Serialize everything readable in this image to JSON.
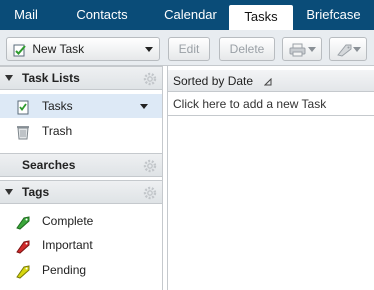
{
  "top_tabs": [
    "Mail",
    "Contacts",
    "Calendar",
    "Tasks",
    "Briefcase"
  ],
  "active_tab": "Tasks",
  "toolbar": {
    "new_task_label": "New Task",
    "edit_label": "Edit",
    "delete_label": "Delete",
    "print_icon": "print-icon",
    "tag_icon": "tag-icon"
  },
  "sidebar": {
    "task_lists_header": "Task Lists",
    "items": [
      {
        "label": "Tasks",
        "icon": "tasks-checklist-icon",
        "selected": true
      },
      {
        "label": "Trash",
        "icon": "trash-icon"
      }
    ],
    "searches_header": "Searches",
    "tags_header": "Tags",
    "tags": [
      {
        "label": "Complete",
        "color": "#3aa63a"
      },
      {
        "label": "Important",
        "color": "#d02a2a"
      },
      {
        "label": "Pending",
        "color": "#d6d60e"
      }
    ]
  },
  "list": {
    "sort_label": "Sorted by Date",
    "add_placeholder": "Click here to add a new Task"
  },
  "colors": {
    "topbar": "#0a4c78",
    "selection": "#dde9f6"
  }
}
